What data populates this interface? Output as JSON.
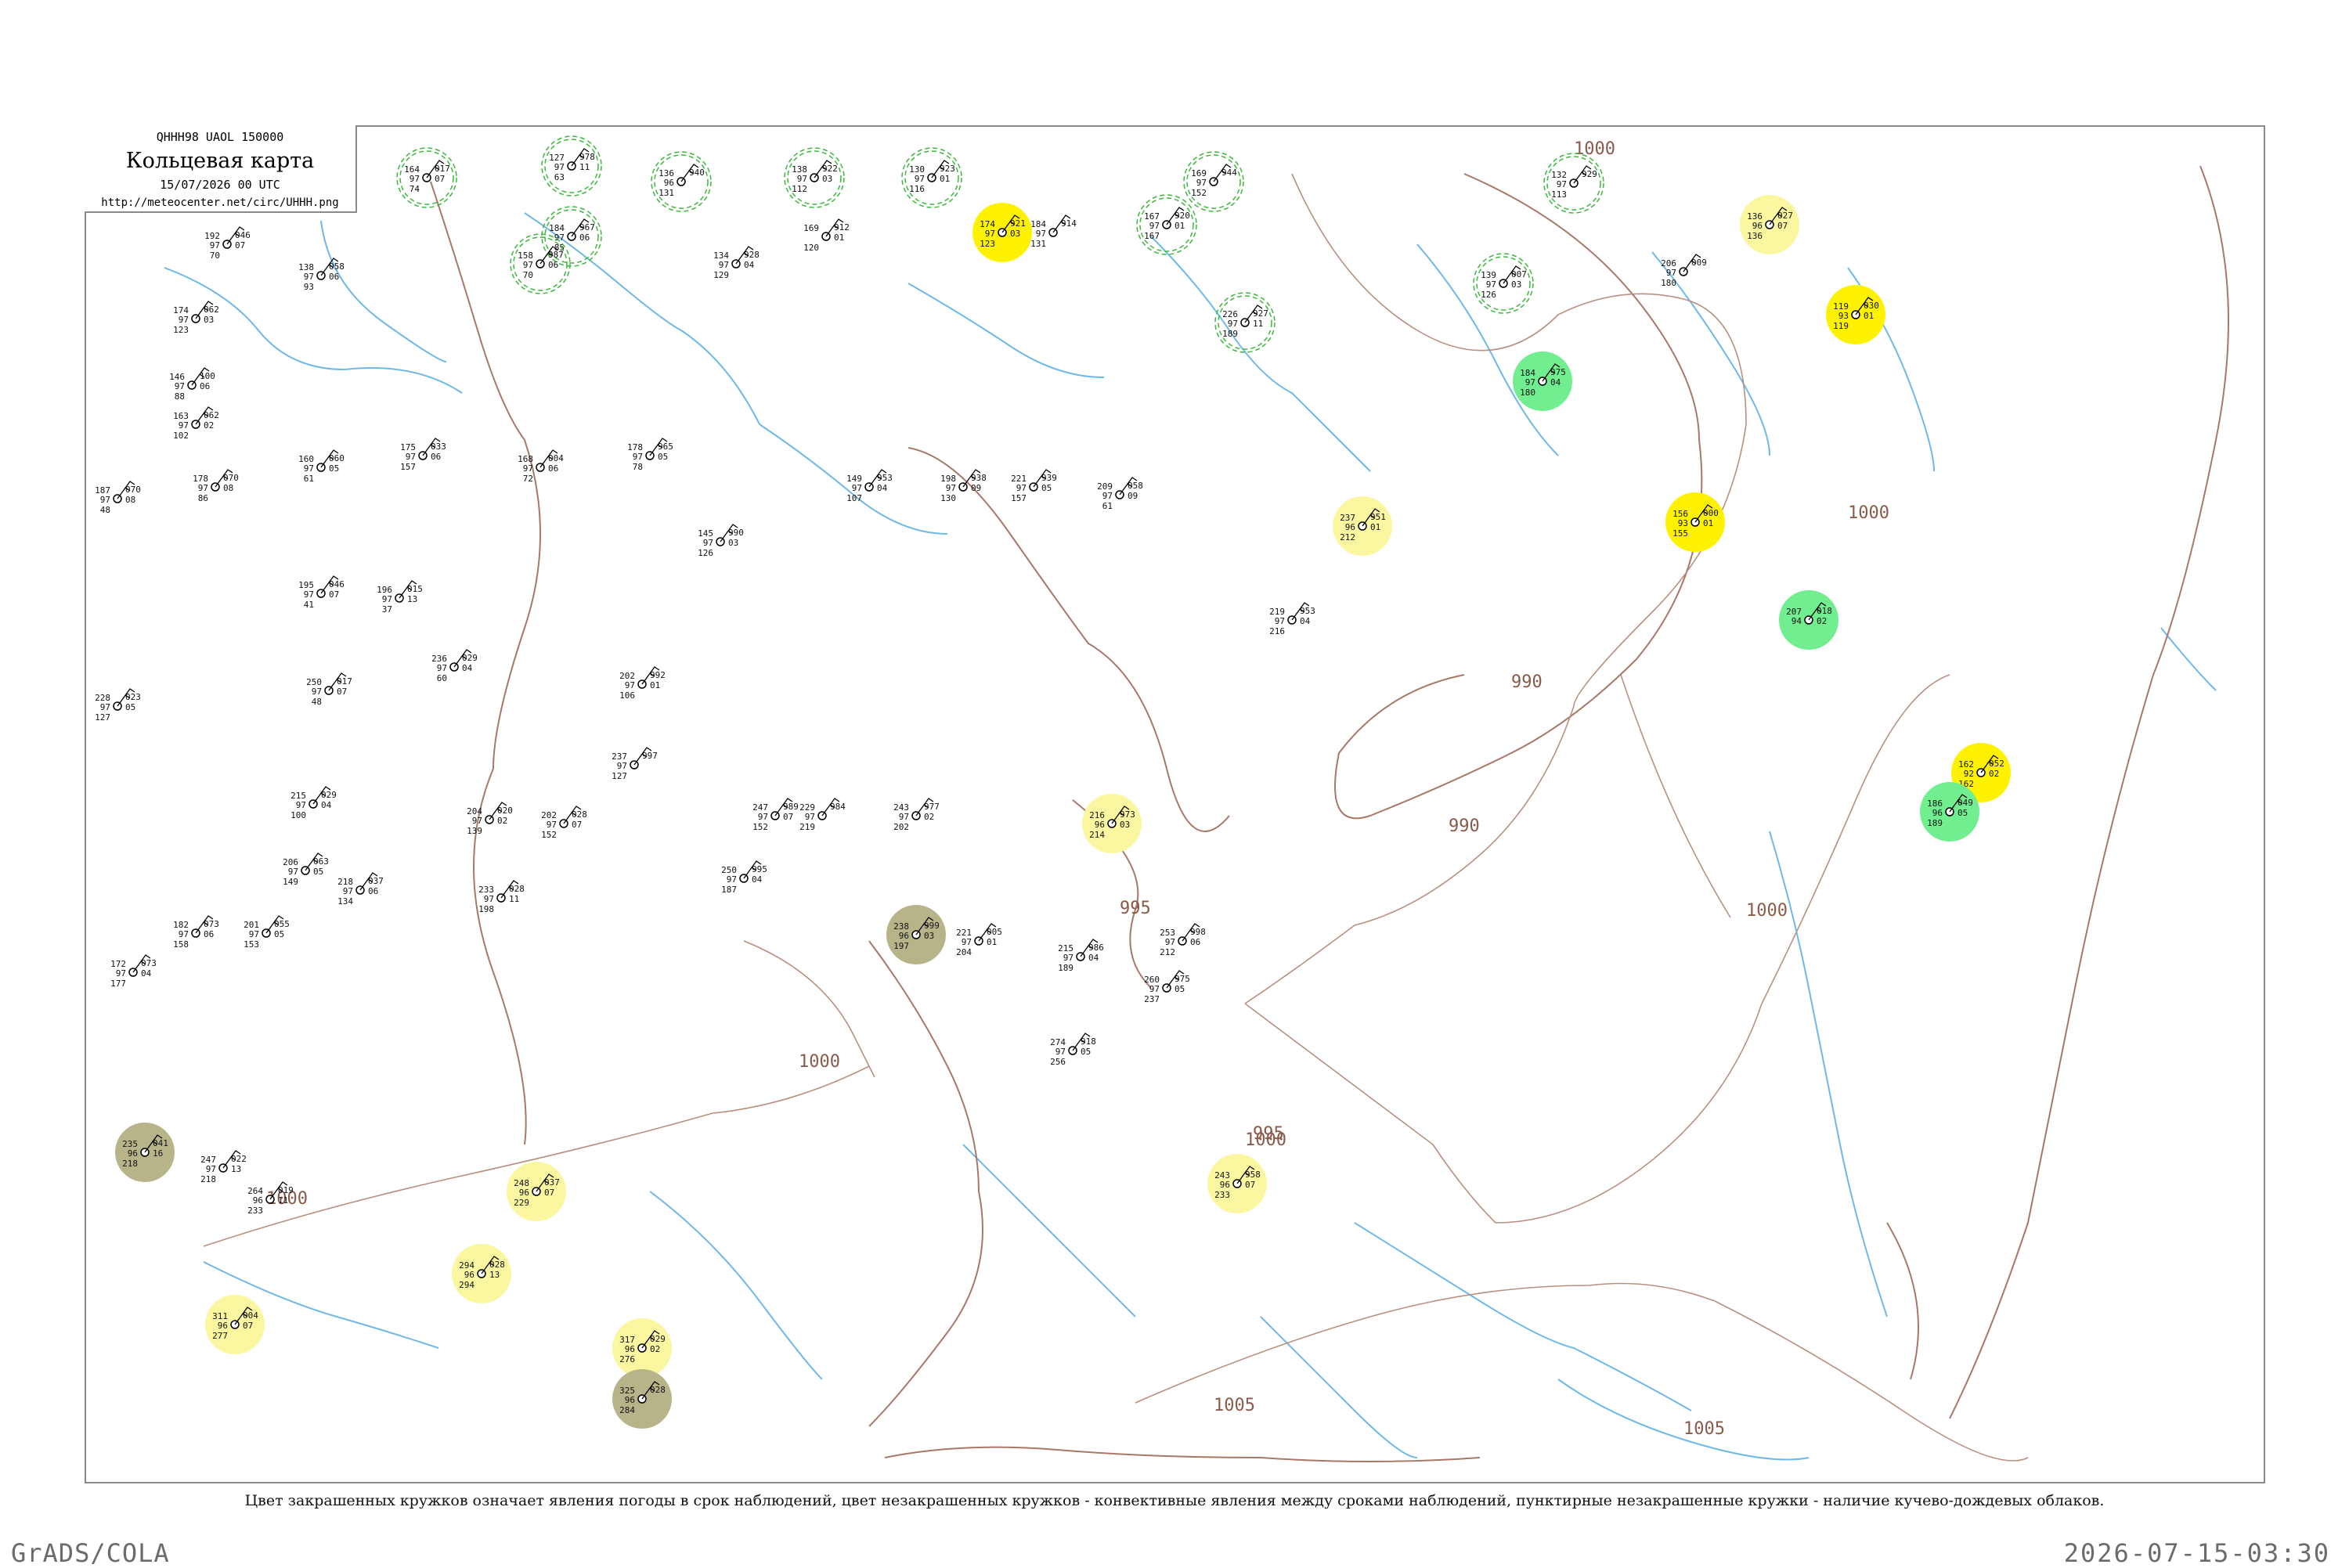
{
  "header": {
    "code": "QHHH98  UAOL  150000",
    "title": "Кольцевая карта",
    "date": "15/07/2026 00 UTC",
    "url": "http://meteocenter.net/circ/UHHH.png"
  },
  "caption": "Цвет закрашенных кружков означает явления погоды в срок наблюдений, цвет незакрашенных кружков - конвективные явления между сроками наблюдений, пунктирные незакрашенные кружки - наличие кучево-дождевых облаков.",
  "footer": {
    "left": "GrADS/COLA",
    "right": "2026-07-15-03:30"
  },
  "colors": {
    "green": "#10c030",
    "light_green": "#70ee90",
    "yellow": "#fff200",
    "light_yellow": "#fbf7a0",
    "olive": "#b8b48a",
    "contour": "#a8786a",
    "river": "#6fb8e8",
    "ring": "#3cb83c"
  },
  "isobars": [
    "1000",
    "995",
    "990",
    "1005"
  ],
  "stations": [
    {
      "t": "164",
      "p": "017",
      "b": "97",
      "c": "07",
      "d": "74"
    },
    {
      "t": "127",
      "p": "978",
      "b": "97",
      "c": "11",
      "d": "63"
    },
    {
      "t": "136",
      "p": "940",
      "b": "96",
      "c": "",
      "d": "131"
    },
    {
      "t": "138",
      "p": "922",
      "b": "97",
      "c": "03",
      "d": "112"
    },
    {
      "t": "130",
      "p": "923",
      "b": "97",
      "c": "01",
      "d": "116"
    },
    {
      "t": "174",
      "p": "921",
      "b": "97",
      "c": "03",
      "d": "123"
    },
    {
      "t": "169",
      "p": "944",
      "b": "97",
      "c": "",
      "d": "152"
    },
    {
      "t": "132",
      "p": "929",
      "b": "97",
      "c": "",
      "d": "113"
    },
    {
      "t": "136",
      "p": "027",
      "b": "96",
      "c": "07",
      "d": "136"
    },
    {
      "t": "192",
      "p": "046",
      "b": "97",
      "c": "07",
      "d": "70"
    },
    {
      "t": "184",
      "p": "967",
      "b": "97",
      "c": "06",
      "d": "85"
    },
    {
      "t": "158",
      "p": "987",
      "b": "97",
      "c": "06",
      "d": "70"
    },
    {
      "t": "138",
      "p": "058",
      "b": "97",
      "c": "06",
      "d": "93"
    },
    {
      "t": "134",
      "p": "928",
      "b": "97",
      "c": "04",
      "d": "129"
    },
    {
      "t": "169",
      "p": "912",
      "b": "",
      "c": "01",
      "d": "120"
    },
    {
      "t": "184",
      "p": "914",
      "b": "97",
      "c": "",
      "d": "131"
    },
    {
      "t": "167",
      "p": "920",
      "b": "97",
      "c": "01",
      "d": "167"
    },
    {
      "t": "226",
      "p": "927",
      "b": "97",
      "c": "11",
      "d": "189"
    },
    {
      "t": "139",
      "p": "007",
      "b": "97",
      "c": "03",
      "d": "126"
    },
    {
      "t": "206",
      "p": "009",
      "b": "97",
      "c": "",
      "d": "180"
    },
    {
      "t": "174",
      "p": "062",
      "b": "97",
      "c": "03",
      "d": "123"
    },
    {
      "t": "146",
      "p": "100",
      "b": "97",
      "c": "06",
      "d": "88"
    },
    {
      "t": "163",
      "p": "062",
      "b": "97",
      "c": "02",
      "d": "102"
    },
    {
      "t": "178",
      "p": "070",
      "b": "97",
      "c": "08",
      "d": "86"
    },
    {
      "t": "187",
      "p": "070",
      "b": "97",
      "c": "08",
      "d": "48"
    },
    {
      "t": "160",
      "p": "060",
      "b": "97",
      "c": "05",
      "d": "61"
    },
    {
      "t": "175",
      "p": "033",
      "b": "97",
      "c": "06",
      "d": "157"
    },
    {
      "t": "168",
      "p": "004",
      "b": "97",
      "c": "06",
      "d": "72"
    },
    {
      "t": "178",
      "p": "965",
      "b": "97",
      "c": "05",
      "d": "78"
    },
    {
      "t": "145",
      "p": "990",
      "b": "97",
      "c": "03",
      "d": "126"
    },
    {
      "t": "149",
      "p": "953",
      "b": "97",
      "c": "04",
      "d": "107"
    },
    {
      "t": "198",
      "p": "938",
      "b": "97",
      "c": "09",
      "d": "130"
    },
    {
      "t": "221",
      "p": "939",
      "b": "97",
      "c": "05",
      "d": "157"
    },
    {
      "t": "209",
      "p": "058",
      "b": "97",
      "c": "09",
      "d": "61"
    },
    {
      "t": "195",
      "p": "046",
      "b": "97",
      "c": "07",
      "d": "41"
    },
    {
      "t": "196",
      "p": "015",
      "b": "97",
      "c": "13",
      "d": "37"
    },
    {
      "t": "236",
      "p": "029",
      "b": "97",
      "c": "04",
      "d": "60"
    },
    {
      "t": "250",
      "p": "017",
      "b": "97",
      "c": "07",
      "d": "48"
    },
    {
      "t": "228",
      "p": "023",
      "b": "97",
      "c": "05",
      "d": "127"
    },
    {
      "t": "202",
      "p": "992",
      "b": "97",
      "c": "01",
      "d": "106"
    },
    {
      "t": "237",
      "p": "997",
      "b": "97",
      "c": "",
      "d": "127"
    },
    {
      "t": "215",
      "p": "029",
      "b": "97",
      "c": "04",
      "d": "100"
    },
    {
      "t": "206",
      "p": "063",
      "b": "97",
      "c": "05",
      "d": "149"
    },
    {
      "t": "218",
      "p": "037",
      "b": "97",
      "c": "06",
      "d": "134"
    },
    {
      "t": "201",
      "p": "055",
      "b": "97",
      "c": "05",
      "d": "153"
    },
    {
      "t": "182",
      "p": "073",
      "b": "97",
      "c": "06",
      "d": "158"
    },
    {
      "t": "172",
      "p": "073",
      "b": "97",
      "c": "04",
      "d": "177"
    },
    {
      "t": "233",
      "p": "028",
      "b": "97",
      "c": "11",
      "d": "198"
    },
    {
      "t": "204",
      "p": "020",
      "b": "97",
      "c": "02",
      "d": "139"
    },
    {
      "t": "202",
      "p": "028",
      "b": "97",
      "c": "07",
      "d": "152"
    },
    {
      "t": "250",
      "p": "995",
      "b": "97",
      "c": "04",
      "d": "187"
    },
    {
      "t": "247",
      "p": "989",
      "b": "97",
      "c": "07",
      "d": "152"
    },
    {
      "t": "229",
      "p": "984",
      "b": "97",
      "c": "",
      "d": "219"
    },
    {
      "t": "243",
      "p": "977",
      "b": "97",
      "c": "02",
      "d": "202"
    },
    {
      "t": "238",
      "p": "999",
      "b": "96",
      "c": "03",
      "d": "197"
    },
    {
      "t": "216",
      "p": "973",
      "b": "96",
      "c": "03",
      "d": "214"
    },
    {
      "t": "221",
      "p": "005",
      "b": "97",
      "c": "01",
      "d": "204"
    },
    {
      "t": "215",
      "p": "986",
      "b": "97",
      "c": "04",
      "d": "189"
    },
    {
      "t": "253",
      "p": "998",
      "b": "97",
      "c": "06",
      "d": "212"
    },
    {
      "t": "274",
      "p": "918",
      "b": "97",
      "c": "05",
      "d": "256"
    },
    {
      "t": "260",
      "p": "975",
      "b": "97",
      "c": "05",
      "d": "237"
    },
    {
      "t": "235",
      "p": "041",
      "b": "96",
      "c": "16",
      "d": "218"
    },
    {
      "t": "247",
      "p": "022",
      "b": "97",
      "c": "13",
      "d": "218"
    },
    {
      "t": "264",
      "p": "019",
      "b": "96",
      "c": "11",
      "d": "233"
    },
    {
      "t": "248",
      "p": "037",
      "b": "96",
      "c": "07",
      "d": "229"
    },
    {
      "t": "294",
      "p": "028",
      "b": "96",
      "c": "13",
      "d": "294"
    },
    {
      "t": "311",
      "p": "004",
      "b": "96",
      "c": "07",
      "d": "277"
    },
    {
      "t": "317",
      "p": "029",
      "b": "96",
      "c": "02",
      "d": "276"
    },
    {
      "t": "325",
      "p": "028",
      "b": "96",
      "c": "",
      "d": "284"
    },
    {
      "t": "243",
      "p": "958",
      "b": "96",
      "c": "07",
      "d": "233"
    },
    {
      "t": "237",
      "p": "951",
      "b": "96",
      "c": "01",
      "d": "212"
    },
    {
      "t": "219",
      "p": "953",
      "b": "97",
      "c": "04",
      "d": "216"
    },
    {
      "t": "156",
      "p": "000",
      "b": "93",
      "c": "01",
      "d": "155"
    },
    {
      "t": "119",
      "p": "030",
      "b": "93",
      "c": "01",
      "d": "119"
    },
    {
      "t": "162",
      "p": "052",
      "b": "92",
      "c": "02",
      "d": "162"
    },
    {
      "t": "207",
      "p": "018",
      "b": "94",
      "c": "02",
      "d": ""
    },
    {
      "t": "184",
      "p": "975",
      "b": "97",
      "c": "04",
      "d": "180"
    },
    {
      "t": "186",
      "p": "049",
      "b": "96",
      "c": "05",
      "d": "189"
    }
  ]
}
